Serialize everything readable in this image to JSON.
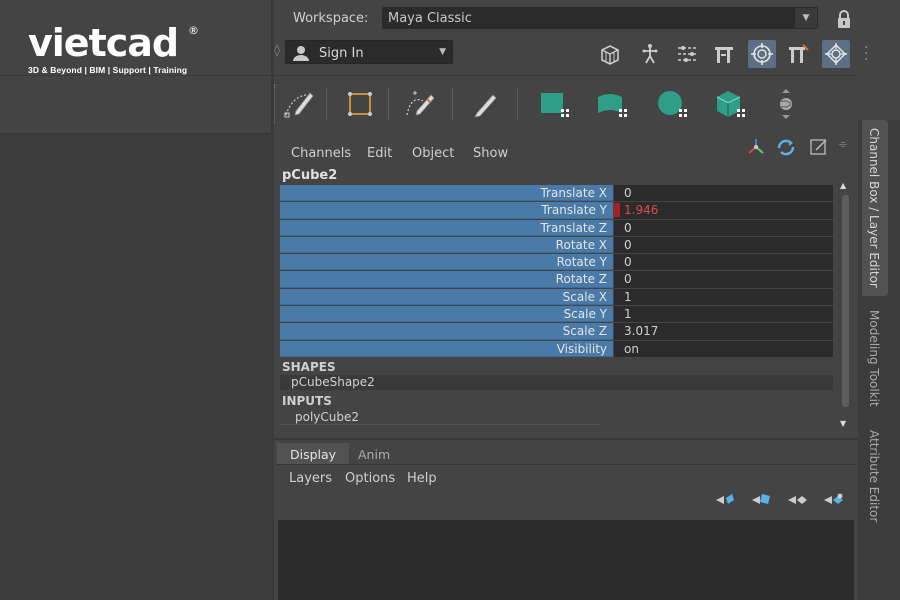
{
  "logo": {
    "word": "vietcad",
    "reg": "®",
    "tagline": "3D & Beyond | BIM | Support | Training"
  },
  "workspace": {
    "label": "Workspace:",
    "value": "Maya Classic"
  },
  "signin": {
    "label": "Sign In"
  },
  "channel_box": {
    "menu": [
      "Channels",
      "Edit",
      "Object",
      "Show"
    ],
    "object_name": "pCube2",
    "attributes": [
      {
        "name": "Translate X",
        "value": "0",
        "keyed": false
      },
      {
        "name": "Translate Y",
        "value": "1.946",
        "keyed": true
      },
      {
        "name": "Translate Z",
        "value": "0",
        "keyed": false
      },
      {
        "name": "Rotate X",
        "value": "0",
        "keyed": false
      },
      {
        "name": "Rotate Y",
        "value": "0",
        "keyed": false
      },
      {
        "name": "Rotate Z",
        "value": "0",
        "keyed": false
      },
      {
        "name": "Scale X",
        "value": "1",
        "keyed": false
      },
      {
        "name": "Scale Y",
        "value": "1",
        "keyed": false
      },
      {
        "name": "Scale Z",
        "value": "3.017",
        "keyed": false
      },
      {
        "name": "Visibility",
        "value": "on",
        "keyed": false
      }
    ],
    "shapes_header": "SHAPES",
    "shape_item": "pCubeShape2",
    "inputs_header": "INPUTS",
    "input_item": "polyCube2"
  },
  "layer_editor": {
    "tabs": [
      "Display",
      "Anim"
    ],
    "active_tab": "Display",
    "menu": [
      "Layers",
      "Options",
      "Help"
    ]
  },
  "side_tabs": [
    "Channel Box / Layer Editor",
    "Modeling Toolkit",
    "Attribute Editor"
  ],
  "colors": {
    "attr_name_bg": "#4a7aa8",
    "keyed_value": "#e04848",
    "panel_bg": "#444444"
  }
}
